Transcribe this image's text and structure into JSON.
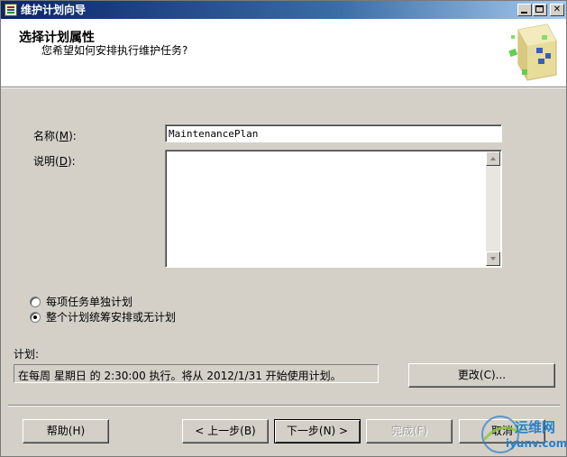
{
  "window": {
    "title": "维护计划向导"
  },
  "header": {
    "title": "选择计划属性",
    "subtitle": "您希望如何安排执行维护任务?"
  },
  "form": {
    "name_label": "名称",
    "name_accel": "M",
    "name_value": "MaintenancePlan",
    "desc_label": "说明",
    "desc_accel": "D",
    "desc_value": ""
  },
  "schedule_options": [
    {
      "label": "每项任务单独计划",
      "checked": false
    },
    {
      "label": "整个计划统筹安排或无计划",
      "checked": true
    }
  ],
  "schedule": {
    "label": "计划:",
    "text": "在每周 星期日 的 2:30:00 执行。将从 2012/1/31 开始使用计划。",
    "change_label": "更改(C)..."
  },
  "buttons": {
    "help": "帮助(H)",
    "prev": "< 上一步(B)",
    "next": "下一步(N) >",
    "finish": "完成(F)",
    "cancel": "取消"
  },
  "watermark": {
    "text": "运维网",
    "sub": "iyunv.com"
  }
}
